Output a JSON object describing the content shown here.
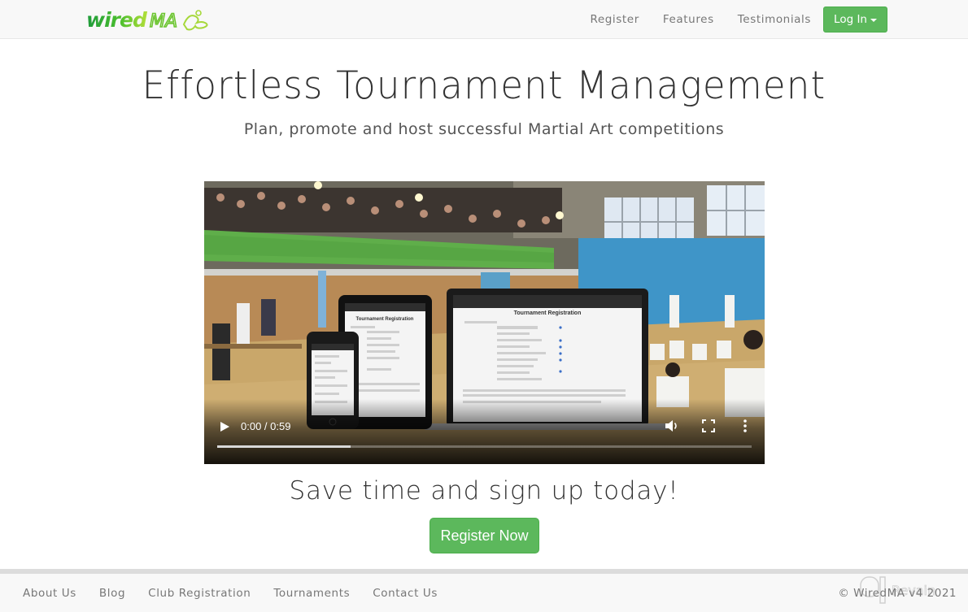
{
  "navbar": {
    "logo_text": "wiredMA",
    "links": [
      {
        "label": "Register"
      },
      {
        "label": "Features"
      },
      {
        "label": "Testimonials"
      }
    ],
    "login_label": "Log In",
    "brand_color": "#5cb85c"
  },
  "hero": {
    "title": "Effortless Tournament Management",
    "subtitle": "Plan, promote and host successful Martial Art competitions"
  },
  "video": {
    "time_display": "0:00 / 0:59",
    "current_time": "0:00",
    "duration": "0:59",
    "buffered_fraction": 0.25,
    "screen_title": "Tournament Registration",
    "controls": {
      "play_icon": "play-icon",
      "volume_icon": "volume-icon",
      "fullscreen_icon": "fullscreen-icon",
      "more_icon": "more-options-icon"
    }
  },
  "cta": {
    "title": "Save time and sign up today!",
    "button_label": "Register Now"
  },
  "footer": {
    "links": [
      {
        "label": "About Us"
      },
      {
        "label": "Blog"
      },
      {
        "label": "Club Registration"
      },
      {
        "label": "Tournaments"
      },
      {
        "label": "Contact Us"
      }
    ],
    "copyright": "© WiredMA v4 2021",
    "watermark": "Revain"
  }
}
